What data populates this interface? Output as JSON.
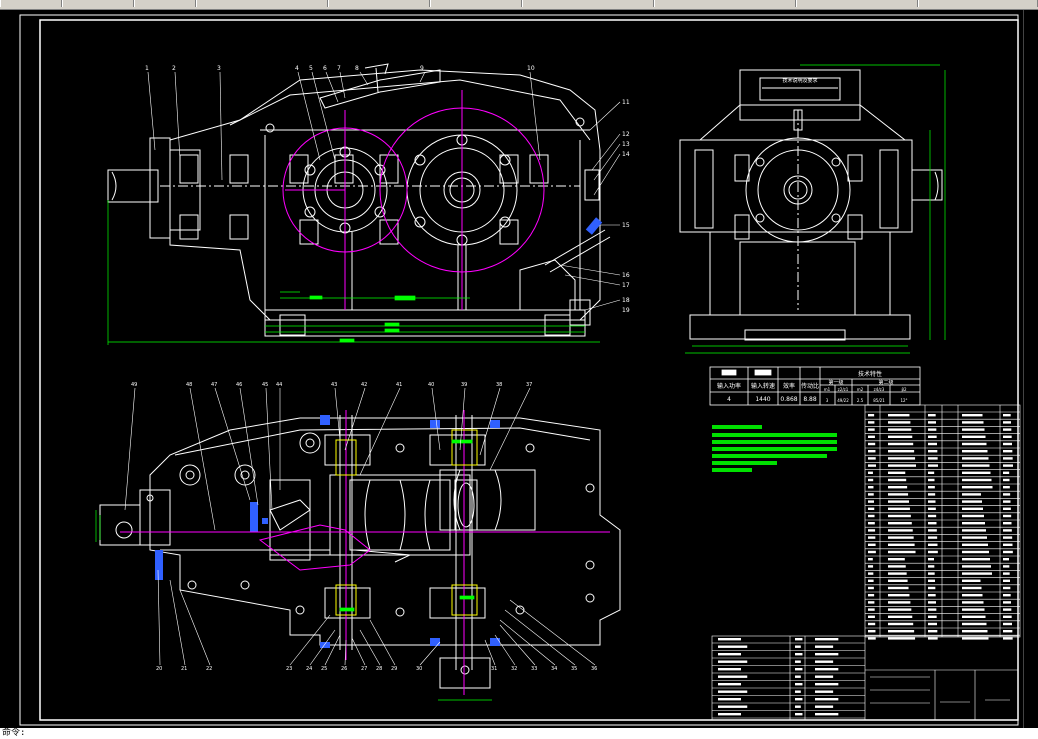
{
  "colors": {
    "background": "#000000",
    "line": "#ffffff",
    "magenta": "#ff00ff",
    "green": "#00ff00",
    "notes": "#00e000",
    "yellow": "#ffff00",
    "cyan": "#00ffff",
    "blue": "#3060ff"
  },
  "command_line": {
    "prompt": "命令: "
  },
  "drawing": {
    "front_view": {
      "balloons": [
        "1",
        "2",
        "3",
        "4",
        "5",
        "6",
        "7",
        "8",
        "9",
        "10",
        "11",
        "12",
        "13",
        "14",
        "15",
        "16",
        "17",
        "18",
        "19"
      ]
    },
    "side_view": {
      "title": "技术说明及要求"
    },
    "bottom_view": {
      "balloons": [
        "20",
        "21",
        "22",
        "23",
        "24",
        "25",
        "26",
        "27",
        "28",
        "29",
        "30",
        "31",
        "32",
        "33",
        "34",
        "35",
        "36",
        "37",
        "38",
        "39",
        "40",
        "41",
        "42",
        "43",
        "44",
        "45",
        "46",
        "47",
        "48",
        "49"
      ]
    },
    "spec_table": {
      "title": "技术特性",
      "headers": [
        "输入功率",
        "输入转速",
        "效率",
        "传动比"
      ],
      "values": [
        "4",
        "1440",
        "0.868",
        "8.88"
      ],
      "stage_headers": [
        "第一级",
        "第二级"
      ],
      "stage_row1": [
        "m1",
        "z2/z1",
        "m2",
        "z4/z3",
        "β2"
      ],
      "stage_row2": [
        "3",
        "49/22",
        "2.5",
        "85/21",
        "12°"
      ]
    }
  }
}
